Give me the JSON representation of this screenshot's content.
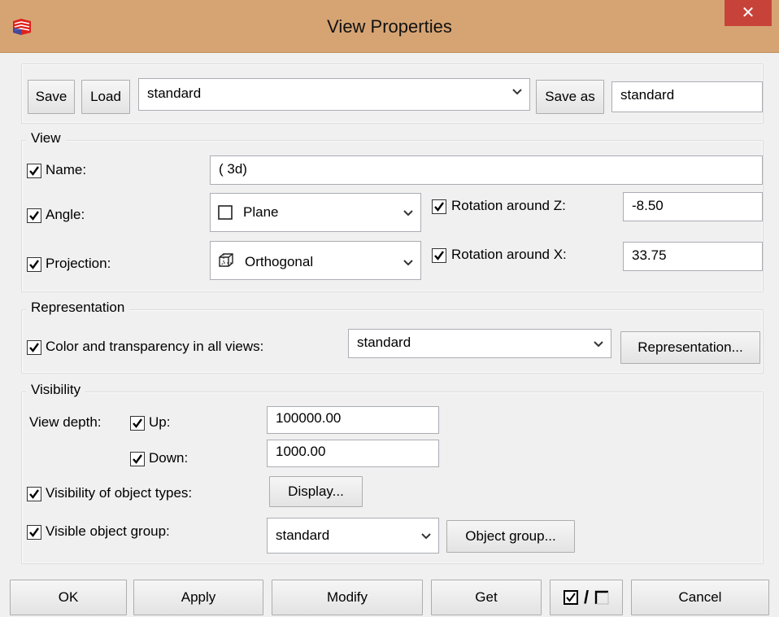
{
  "window": {
    "title": "View Properties",
    "close_symbol": "✕"
  },
  "toolbar": {
    "save_label": "Save",
    "load_label": "Load",
    "preset_select": "standard",
    "save_as_label": "Save as",
    "save_as_value": "standard"
  },
  "view": {
    "title": "View",
    "name_label": "Name:",
    "name_value": "( 3d)",
    "angle_label": "Angle:",
    "angle_value": "Plane",
    "rotation_z_label": "Rotation around Z:",
    "rotation_z_value": "-8.50",
    "projection_label": "Projection:",
    "projection_value": "Orthogonal",
    "rotation_x_label": "Rotation around X:",
    "rotation_x_value": "33.75"
  },
  "representation": {
    "title": "Representation",
    "color_label": "Color and transparency in all views:",
    "color_value": "standard",
    "button_label": "Representation..."
  },
  "visibility": {
    "title": "Visibility",
    "view_depth_label": "View depth:",
    "up_label": "Up:",
    "up_value": "100000.00",
    "down_label": "Down:",
    "down_value": "1000.00",
    "object_types_label": "Visibility of object types:",
    "display_button": "Display...",
    "object_group_label": "Visible object group:",
    "object_group_value": "standard",
    "object_group_button": "Object group..."
  },
  "footer": {
    "ok": "OK",
    "apply": "Apply",
    "modify": "Modify",
    "get": "Get",
    "toggle_separator": "/",
    "cancel": "Cancel"
  },
  "icons": {
    "app": "app-logo-icon",
    "dropdown": "chevron-down-icon",
    "check": "checkmark-icon",
    "plane": "square-icon",
    "projection": "cube-icon"
  },
  "colors": {
    "titlebar": "#d6a473",
    "close": "#c7433a",
    "background": "#f0f0f0"
  }
}
